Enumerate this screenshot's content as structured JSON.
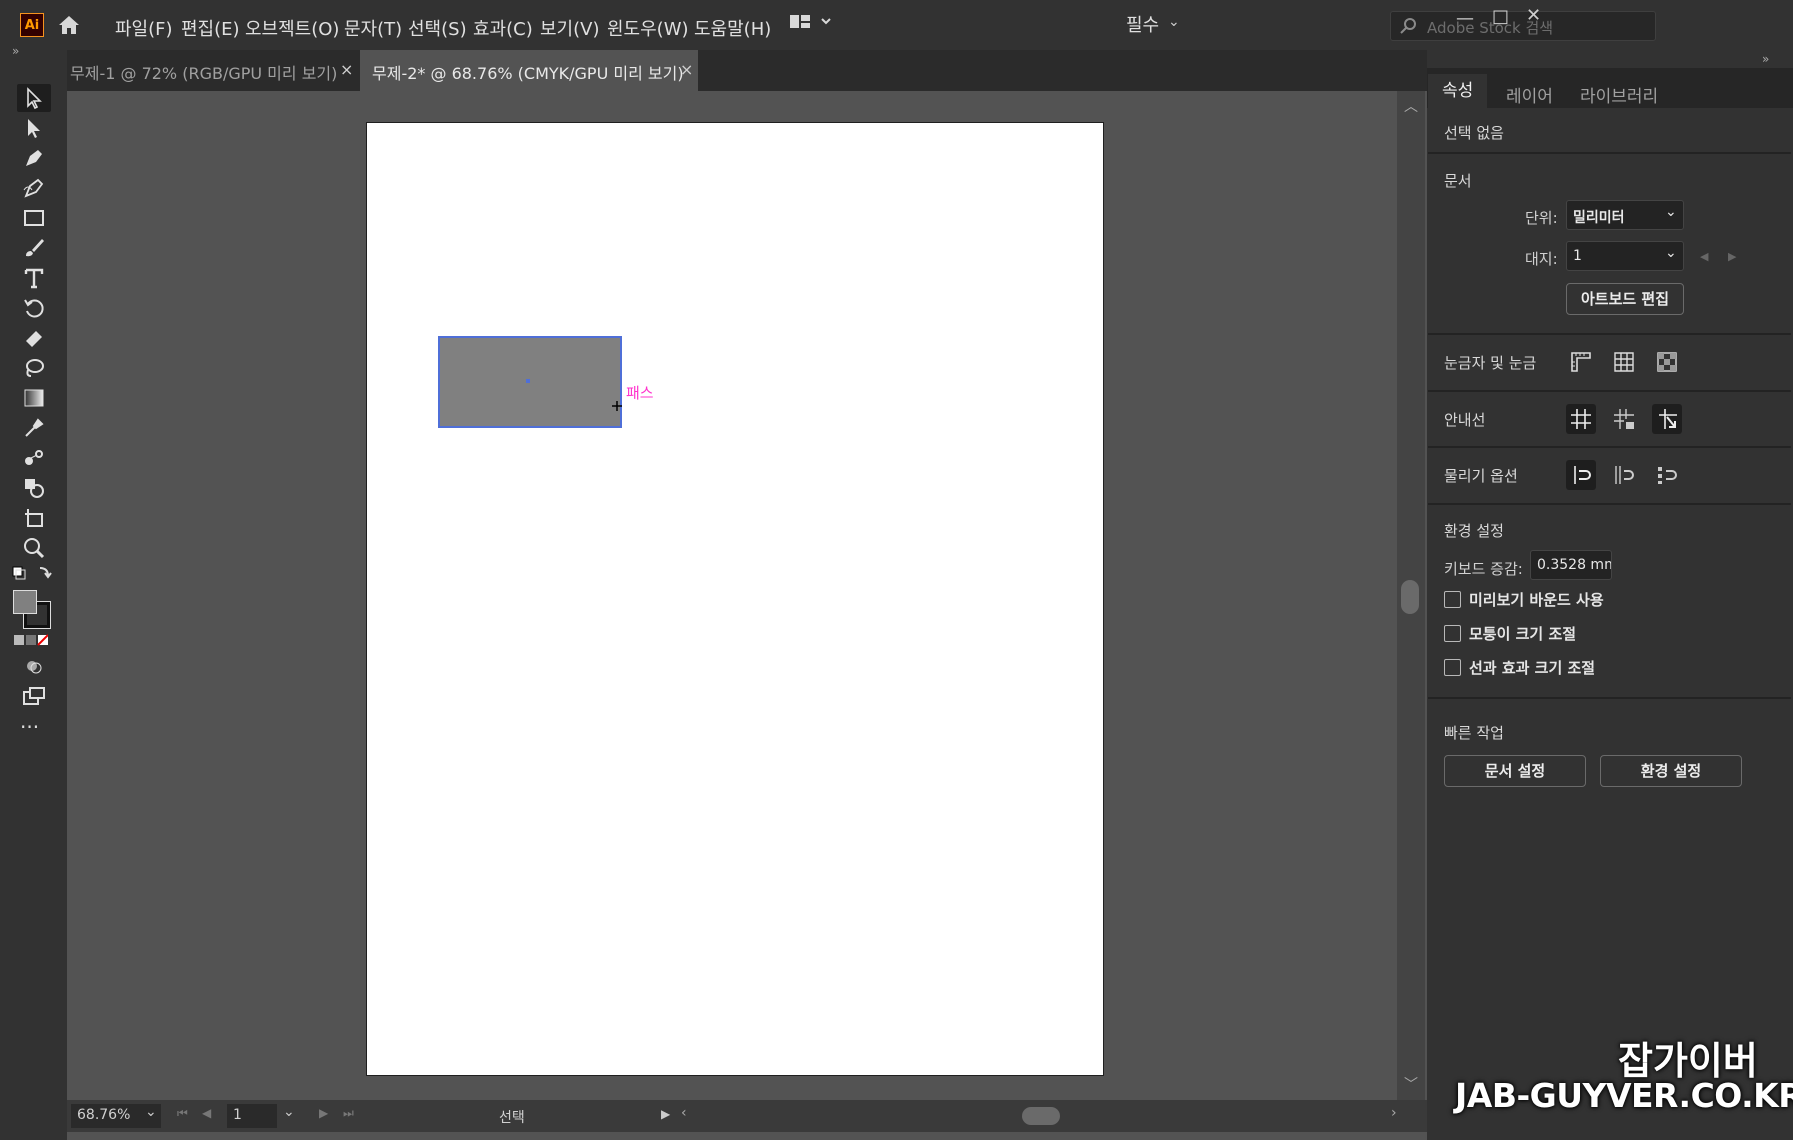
{
  "app": {
    "logo_text": "Ai",
    "menu": [
      "파일(F)",
      "편집(E)",
      "오브젝트(O)",
      "문자(T)",
      "선택(S)",
      "효과(C)",
      "보기(V)",
      "윈도우(W)",
      "도움말(H)"
    ],
    "workspace": "필수",
    "stock_search_placeholder": "Adobe Stock 검색",
    "window_controls": [
      "—",
      "□",
      "✕"
    ]
  },
  "tabs": [
    {
      "label": "무제-1 @ 72% (RGB/GPU 미리 보기)",
      "close": "×",
      "active": false
    },
    {
      "label": "무제-2* @ 68.76% (CMYK/GPU 미리 보기)",
      "close": "×",
      "active": true
    }
  ],
  "tools": [
    "selection-tool",
    "direct-selection-tool",
    "pen-tool",
    "curvature-tool",
    "rectangle-tool",
    "paintbrush-tool",
    "type-tool",
    "rotate-tool",
    "eraser-tool",
    "lasso-tool",
    "gradient-tool",
    "eyedropper-tool",
    "blend-tool",
    "shape-builder-tool",
    "artboard-tool",
    "zoom-tool"
  ],
  "canvas": {
    "hover_label": "패스"
  },
  "status": {
    "zoom": "68.76%",
    "page": "1",
    "mode": "선택"
  },
  "properties": {
    "tabs": [
      "속성",
      "레이어",
      "라이브러리"
    ],
    "no_selection": "선택 없음",
    "document_title": "문서",
    "units_label": "단위:",
    "units_value": "밀리미터",
    "artboard_label": "대지:",
    "artboard_value": "1",
    "edit_artboard_button": "아트보드 편집",
    "rulers_label": "눈금자 및 눈금",
    "guides_label": "안내선",
    "snap_label": "물리기 옵션",
    "prefs_title": "환경 설정",
    "keyboard_increment_label": "키보드 증감:",
    "keyboard_increment_value": "0.3528 mm",
    "checkboxes": [
      "미리보기 바운드 사용",
      "모퉁이 크기 조절",
      "선과 효과 크기 조절"
    ],
    "quick_actions_title": "빠른 작업",
    "doc_setup_button": "문서 설정",
    "prefs_button": "환경 설정"
  },
  "watermark": {
    "line1": "잡가이버",
    "line2": "JAB-GUYVER.CO.KR"
  },
  "colors": {
    "ui_dark": "#323232",
    "canvas": "#535353",
    "selection": "#4f6fd8",
    "smart_guide": "#ff33cc",
    "fill": "#808080"
  }
}
